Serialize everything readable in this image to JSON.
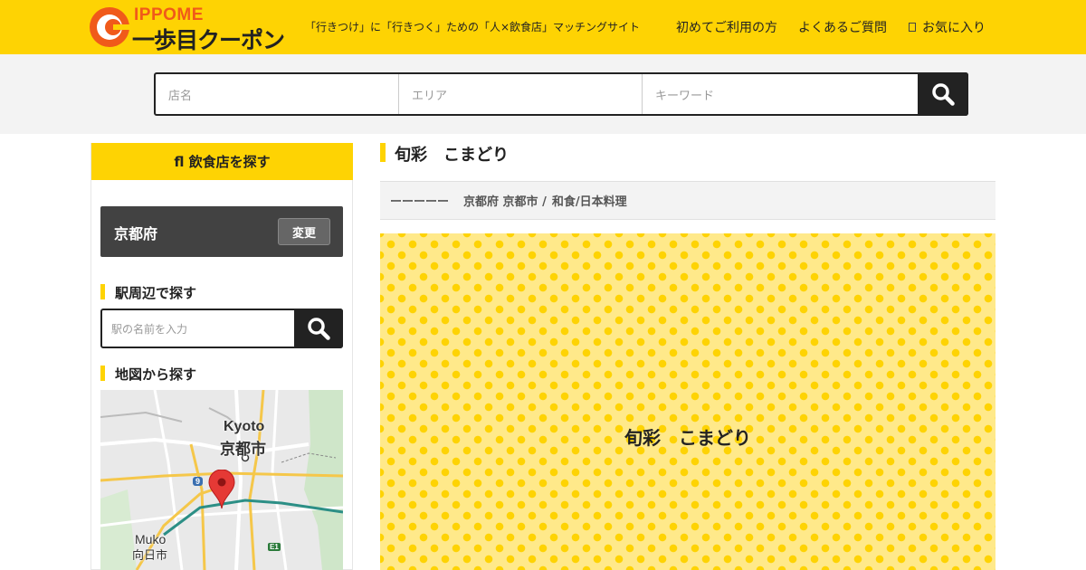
{
  "header": {
    "logo_en": "IPPOME",
    "logo_ja": "一歩目クーポン",
    "tagline": "「行きつけ」に「行きつく」ための「人×飲食店」マッチングサイト",
    "nav": [
      "初めてご利用の方",
      "よくあるご質問",
      "お気に入り"
    ],
    "brand_color": "#fed303",
    "logo_accent": "#f05a1a"
  },
  "search": {
    "shop_placeholder": "店名",
    "area_placeholder": "エリア",
    "keyword_placeholder": "キーワード",
    "button_icon": "search-icon"
  },
  "sidebar": {
    "heading": "fl 飲食店を探す",
    "prefecture": "京都府",
    "change_label": "変更",
    "station_heading": "駅周辺で探す",
    "station_placeholder": "駅の名前を入力",
    "map_heading": "地図から探す",
    "map_labels": {
      "city_en": "Kyoto",
      "city_ja": "京都市",
      "muko_en": "Muko",
      "muko_ja": "向日市",
      "route": "9",
      "expressway": "E1"
    }
  },
  "main": {
    "title": "旬彩　こまどり",
    "rating": "ーーーーー",
    "location": "京都府 京都市 /",
    "genre": "和食/日本料理",
    "hero_title": "旬彩　こまどり"
  }
}
